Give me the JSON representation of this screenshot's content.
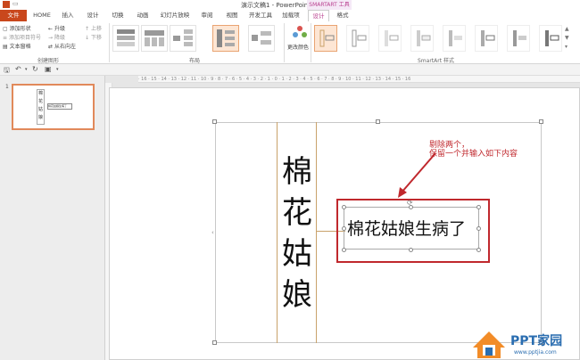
{
  "window": {
    "title": "演示文稿1 - PowerPoint",
    "tool_group": "SMARTART 工具"
  },
  "tabs": [
    "文件",
    "HOME",
    "插入",
    "设计",
    "切换",
    "动画",
    "幻灯片放映",
    "审阅",
    "视图",
    "开发工具",
    "加载项",
    "设计",
    "格式"
  ],
  "ribbon": {
    "create_graphic": {
      "items": [
        "添加形状",
        "添加项目符号",
        "文本窗格",
        "升级",
        "降级",
        "从右向左",
        "上移",
        "下移"
      ],
      "label": "创建图形"
    },
    "layout": {
      "label": "布局"
    },
    "change_colors": "更改颜色",
    "smartart_styles": {
      "label": "SmartArt 样式"
    }
  },
  "slide_panel": {
    "slide_number": "1"
  },
  "ruler_ticks": "· 16 · 15 · 14 · 13 · 12 · 11 · 10 · 9 · 8 · 7 · 6 · 5 · 4 · 3 · 2 · 1 · 0 · 1 · 2 · 3 · 4 · 5 · 6 · 7 · 8 · 9 · 10 · 11 · 12 · 13 · 14 · 15 · 16",
  "slide": {
    "vertical_text": "棉花姑娘",
    "box_text": "棉花姑娘生病了",
    "annotation_line1": "剔除两个，",
    "annotation_line2": "保留一个并输入如下内容",
    "annotation_color": "#c0282d"
  },
  "watermark": {
    "brand": "PPT家园",
    "url": "www.pptjia.com"
  }
}
